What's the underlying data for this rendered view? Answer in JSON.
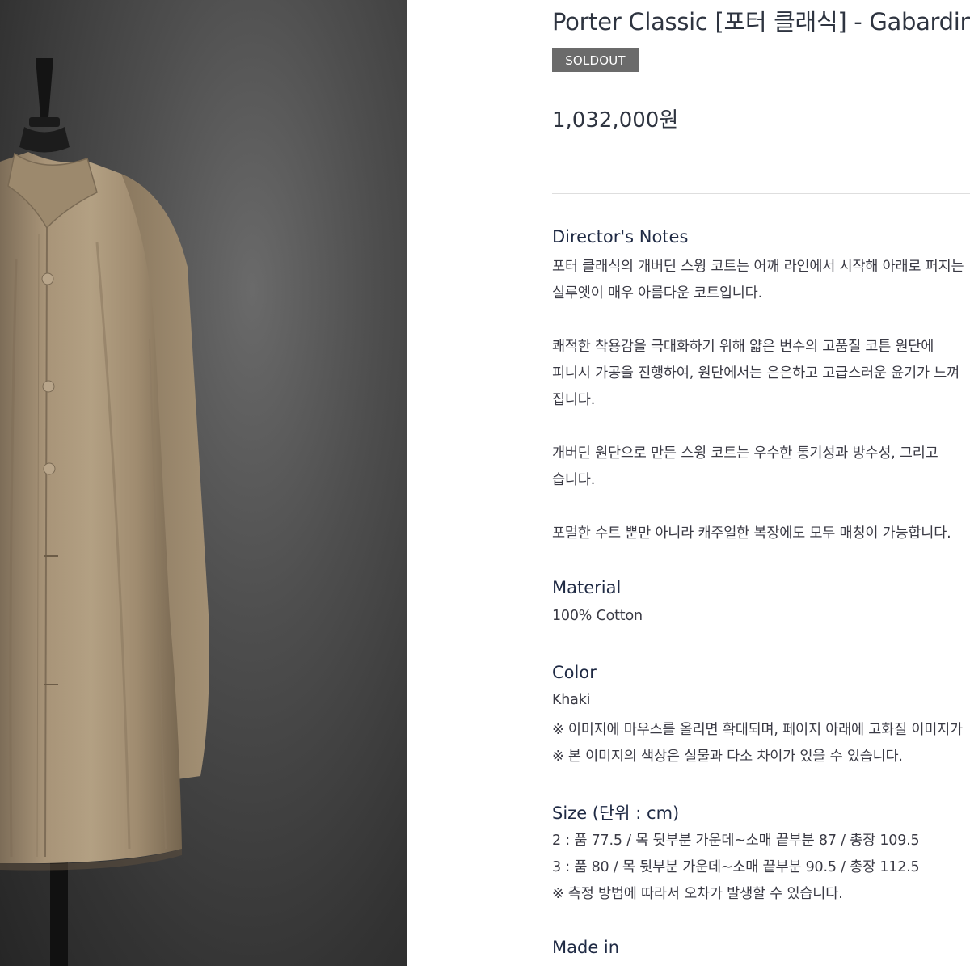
{
  "product": {
    "title": "Porter Classic [포터 클래식] - Gabardine Swing Coat",
    "badge": "SOLDOUT",
    "price": "1,032,000원"
  },
  "directors_notes": {
    "heading": "Director's Notes",
    "lines": [
      "포터 클래식의 개버딘 스윙 코트는 어깨 라인에서 시작해 아래로 퍼지는",
      "실루엣이 매우 아름다운 코트입니다.",
      "쾌적한 착용감을 극대화하기 위해 얇은 번수의 고품질 코튼 원단에",
      "피니시 가공을 진행하여, 원단에서는 은은하고 고급스러운 윤기가 느껴",
      "집니다.",
      "개버딘 원단으로 만든 스윙 코트는 우수한 통기성과 방수성, 그리고",
      "습니다.",
      "포멀한 수트 뿐만 아니라 캐주얼한 복장에도 모두 매칭이 가능합니다."
    ]
  },
  "material": {
    "heading": "Material",
    "value": "100% Cotton"
  },
  "color": {
    "heading": "Color",
    "value": "Khaki",
    "note1": "※ 이미지에 마우스를 올리면 확대되며, 페이지 아래에 고화질 이미지가",
    "note2": "※ 본 이미지의 색상은 실물과 다소 차이가 있을 수 있습니다."
  },
  "size": {
    "heading": "Size (단위 : cm)",
    "rows": [
      "2 : 품 77.5 / 목 뒷부분 가운데~소매 끝부분 87 / 총장 109.5",
      "3 : 품 80 / 목 뒷부분 가운데~소매 끝부분 90.5 / 총장 112.5"
    ],
    "note": "※ 측정 방법에 따라서 오차가 발생할 수 있습니다."
  },
  "made_in": {
    "heading": "Made in"
  },
  "colors": {
    "badge_bg": "#6b6b6b",
    "coat": "#a69276",
    "backdrop": "#3a3a3a"
  }
}
